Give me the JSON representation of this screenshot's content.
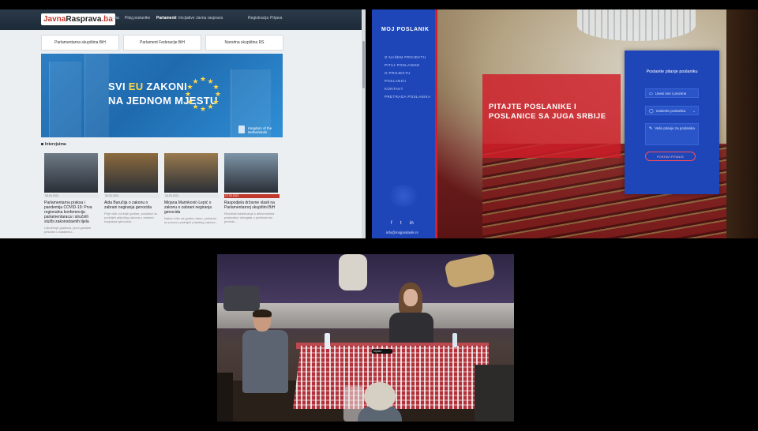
{
  "left_site": {
    "logo_part1": "Javna",
    "logo_part2": "Rasprava",
    "logo_part3": ".ba",
    "nav": [
      "O nama",
      "Pitaj poslanike",
      "Parlamenti",
      "Inicijative",
      "Javna rasprava",
      "Registracija",
      "Prijava"
    ],
    "institutions": [
      "Parlamentarna skupština BiH",
      "Parlament Federacije BiH",
      "Narodna skupština RS"
    ],
    "banner": {
      "line1_a": "SVI ",
      "line1_eu": "EU",
      "line1_b": " ZAKONI",
      "line2": "NA JEDNOM MJESTU",
      "kingdom": "Kingdom of the Netherlands"
    },
    "section_title": "Intervjuima",
    "cards": [
      {
        "meta": "03.04.2021",
        "title": "Parlamentarna praksa i pandemija COVID-19: Prva regionalna konferencija parlamentaraca i stručnih službi zakonodavnih tijela",
        "snippet": "Udruženje građana, javni građani prisutno u sastanku...",
        "thumb": "#6e7a86"
      },
      {
        "meta": "30.03.2021",
        "title": "Aida Baručija o zakonu o zabrani negiranja genocida",
        "snippet": "Prije više od dvije godine, poslanici su podnijeli prijedlog zakona o zabrani negiranja genocida...",
        "thumb": "#8c6b3e"
      },
      {
        "meta": "24.03.2021",
        "title": "Mirjana Marinković-Lepić o zakonu o zabrani negiranja genocida",
        "snippet": "Nakon više od godinu dana, poslanici su ponovo podnijeli prijedlog zakona...",
        "thumb": "#9a7a4e"
      },
      {
        "meta": "17.03.2021",
        "title": "Raspodjela državne vlasti na Parlamentarnoj skupštini BiH",
        "snippet": "Rezultati istraživanja o aktivnostima poslanika i delegata u prethodnom periodu...",
        "thumb": "#7e95a8"
      }
    ]
  },
  "right_site": {
    "logo": "MOJ POSLANIK",
    "menu": [
      "O NAŠEM PROJEKTU",
      "PITAJ POSLANIKE",
      "O PROJEKTU",
      "POSLANICI",
      "KONTAKT",
      "PRETRAGA POSLANIKA"
    ],
    "hero": "PITAJTE POSLANIKE I POSLANICE SA JUGA SRBIJE",
    "form_title": "Postavite pitanje poslaniku",
    "field_name": "Unesi ime i prezime",
    "field_select": "Izaberite poslanika",
    "field_question": "Vaše pitanje za poslanika",
    "submit": "POSTAVI PITANJE",
    "social": [
      "f",
      "t",
      "in"
    ],
    "email": "info@mojposlanik.rs"
  },
  "video": {
    "table_label": "Mjesto"
  }
}
